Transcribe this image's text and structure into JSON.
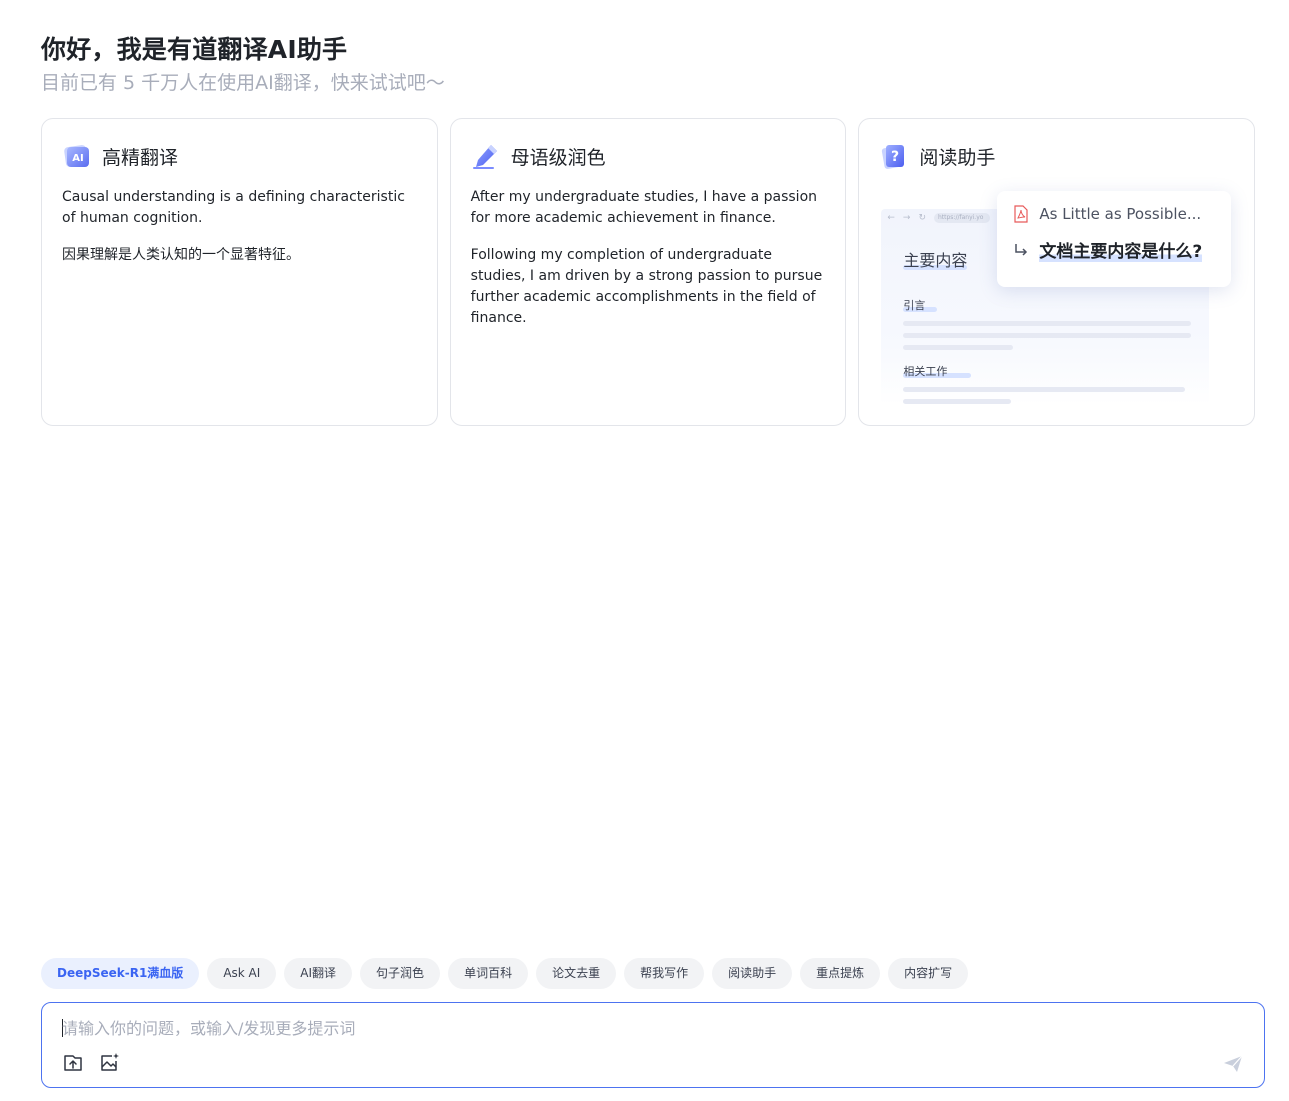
{
  "greeting": {
    "title": "你好，我是有道翻译AI助手",
    "subtitle": "目前已有 5 千万人在使用AI翻译，快来试试吧～"
  },
  "cards": [
    {
      "title": "高精翻译",
      "icon": "ai-translate-icon",
      "paragraphs": [
        "Causal understanding is a defining characteristic of human cognition.",
        "因果理解是人类认知的一个显著特征。"
      ]
    },
    {
      "title": "母语级润色",
      "icon": "pen-icon",
      "paragraphs": [
        "After my undergraduate studies, I have a passion for more academic achievement in finance.",
        "Following my completion of undergraduate studies, I am driven by a strong passion to pursue further academic accomplishments in the field of finance."
      ]
    },
    {
      "title": "阅读助手",
      "icon": "question-book-icon",
      "illustration": {
        "url": "https://fanyi.yo",
        "main_heading": "主要内容",
        "section1": "引言",
        "section2": "相关工作",
        "doc_name": "As Little as Possible...",
        "question": "文档主要内容是什么?",
        "doc_icon": "pdf-icon",
        "reply_icon": "reply-arrow-icon"
      }
    }
  ],
  "chips": [
    {
      "label": "DeepSeek-R1满血版",
      "active": true
    },
    {
      "label": "Ask AI",
      "active": false
    },
    {
      "label": "AI翻译",
      "active": false
    },
    {
      "label": "句子润色",
      "active": false
    },
    {
      "label": "单词百科",
      "active": false
    },
    {
      "label": "论文去重",
      "active": false
    },
    {
      "label": "帮我写作",
      "active": false
    },
    {
      "label": "阅读助手",
      "active": false
    },
    {
      "label": "重点提炼",
      "active": false
    },
    {
      "label": "内容扩写",
      "active": false
    }
  ],
  "input": {
    "placeholder": "请输入你的问题，或输入/发现更多提示词",
    "value": "",
    "tools": [
      "upload-file-icon",
      "image-ai-icon"
    ],
    "send_icon": "send-icon"
  },
  "colors": {
    "accent": "#3a64f2",
    "border_active": "#4d73f0",
    "muted_text": "#a8adba"
  }
}
